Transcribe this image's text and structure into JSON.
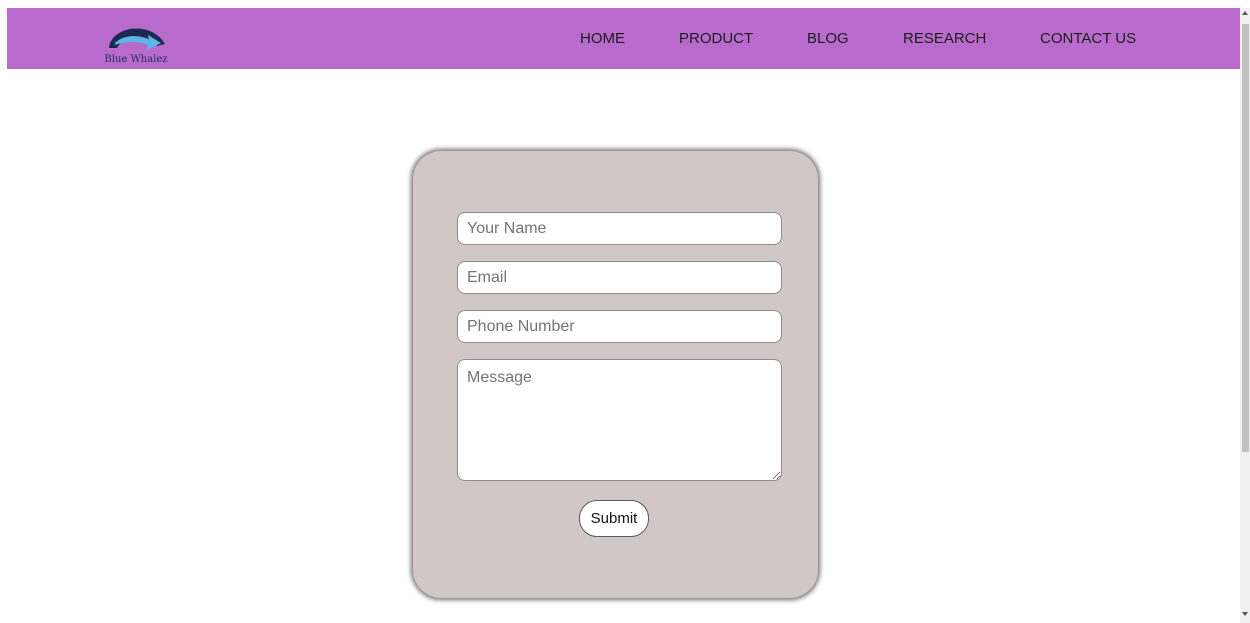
{
  "brand": {
    "name": "Blue Whalez",
    "logo_icon": "whale-arrow-logo",
    "logo_colors": {
      "dark": "#1c2a4f",
      "light": "#5bb7e6"
    }
  },
  "nav": {
    "background": "#b86bcd",
    "items": [
      {
        "label": "HOME"
      },
      {
        "label": "PRODUCT"
      },
      {
        "label": "BLOG"
      },
      {
        "label": "RESEARCH"
      },
      {
        "label": "CONTACT US"
      }
    ]
  },
  "form": {
    "card_background": "#d1c7c7",
    "name_placeholder": "Your Name",
    "email_placeholder": "Email",
    "phone_placeholder": "Phone Number",
    "message_placeholder": "Message",
    "submit_label": "Submit"
  }
}
